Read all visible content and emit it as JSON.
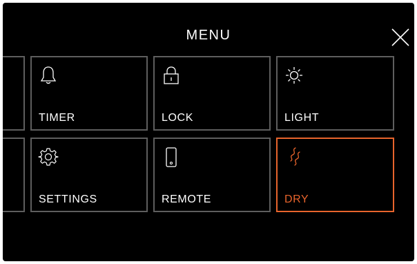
{
  "header": {
    "title": "MENU"
  },
  "tiles": [
    {
      "label": "TIMER",
      "icon": "bell-icon",
      "active": false
    },
    {
      "label": "LOCK",
      "icon": "lock-icon",
      "active": false
    },
    {
      "label": "LIGHT",
      "icon": "sun-icon",
      "active": false
    },
    {
      "label": "SETTINGS",
      "icon": "gear-icon",
      "active": false
    },
    {
      "label": "REMOTE",
      "icon": "phone-icon",
      "active": false
    },
    {
      "label": "DRY",
      "icon": "dry-wave-icon",
      "active": true
    }
  ],
  "colors": {
    "background": "#000000",
    "tile_border": "#5e5e5e",
    "text": "#ffffff",
    "accent": "#e8642c"
  }
}
